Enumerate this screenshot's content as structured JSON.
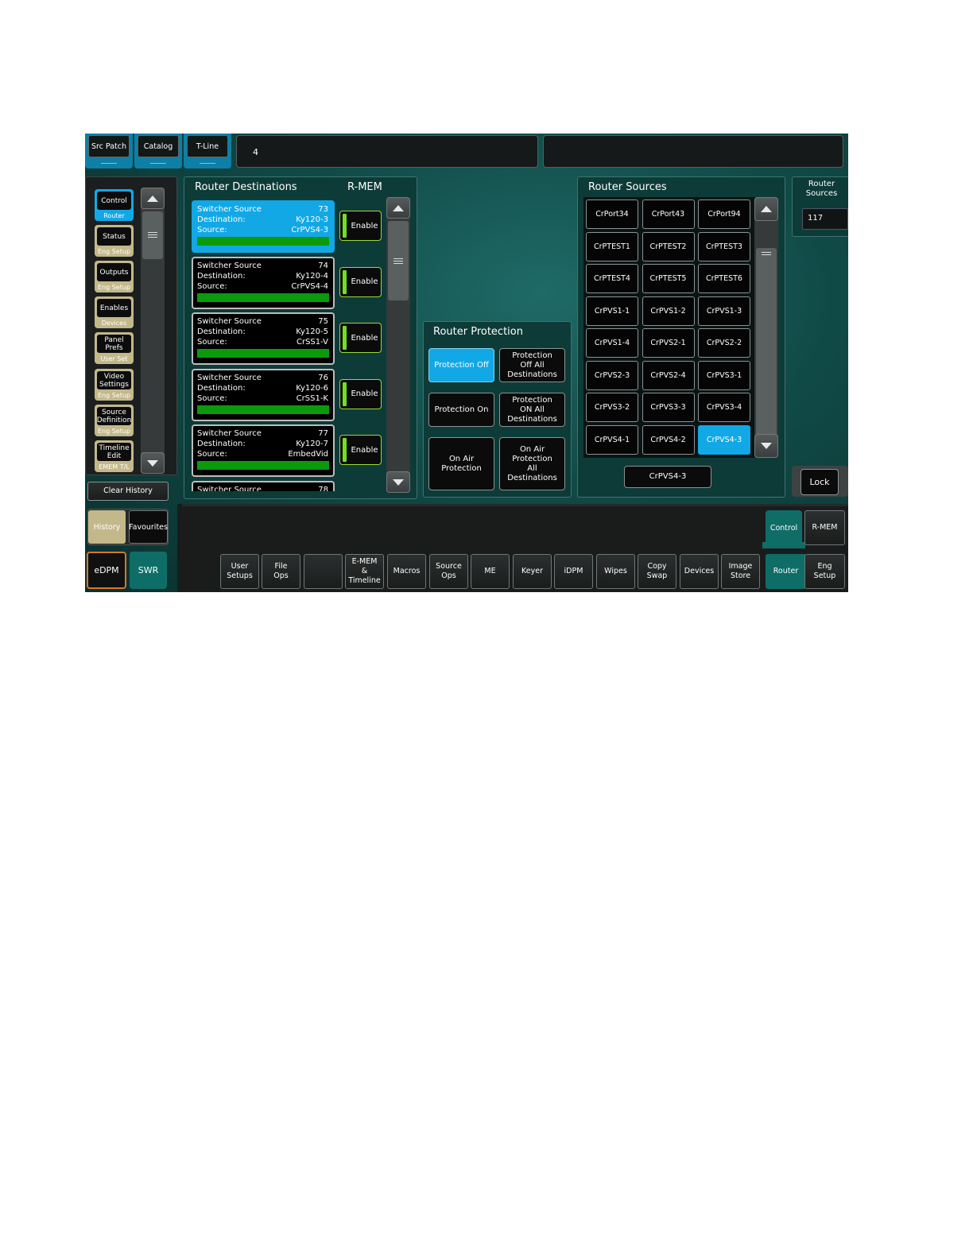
{
  "top_tabs": [
    "Src Patch",
    "Catalog",
    "T-Line"
  ],
  "top_field_value": "4",
  "top_field_right_value": "",
  "sidebar": {
    "items": [
      {
        "label": "Control",
        "sub": "Router",
        "active": true
      },
      {
        "label": "Status",
        "sub": "Eng  Setup"
      },
      {
        "label": "Outputs",
        "sub": "Eng  Setup"
      },
      {
        "label": "Enables",
        "sub": "Devices"
      },
      {
        "label": "Panel Prefs",
        "sub": "User Set"
      },
      {
        "label": "Video Settings",
        "sub": "Eng  Setup"
      },
      {
        "label": "Source Definition",
        "sub": "Eng  Setup"
      },
      {
        "label": "Timeline Edit",
        "sub": "EMEM T/L"
      }
    ],
    "clear_history": "Clear History",
    "history": "History",
    "favourites": "Favourites",
    "edpm": "eDPM",
    "swr": "SWR"
  },
  "destinations": {
    "title": "Router Destinations",
    "rmem_title": "R-MEM",
    "enable_label": "Enable",
    "row_labels": {
      "source_type": "Switcher Source",
      "destination": "Destination:",
      "source": "Source:"
    },
    "items": [
      {
        "num": "73",
        "destination": "Ky120-3",
        "source": "CrPVS4-3",
        "selected": true
      },
      {
        "num": "74",
        "destination": "Ky120-4",
        "source": "CrPVS4-4"
      },
      {
        "num": "75",
        "destination": "Ky120-5",
        "source": "CrSS1-V"
      },
      {
        "num": "76",
        "destination": "Ky120-6",
        "source": "CrSS1-K"
      },
      {
        "num": "77",
        "destination": "Ky120-7",
        "source": "EmbedVid"
      },
      {
        "num": "78",
        "destination": "",
        "source": ""
      }
    ]
  },
  "protection": {
    "title": "Router Protection",
    "buttons": [
      "Protection Off",
      "Protection Off All Destinations",
      "Protection On",
      "Protection ON All Destinations",
      "On Air Protection",
      "On Air Protection All Destinations"
    ]
  },
  "sources": {
    "title": "Router Sources",
    "items": [
      "CrPort34",
      "CrPort43",
      "CrPort94",
      "CrPTEST1",
      "CrPTEST2",
      "CrPTEST3",
      "CrPTEST4",
      "CrPTEST5",
      "CrPTEST6",
      "CrPVS1-1",
      "CrPVS1-2",
      "CrPVS1-3",
      "CrPVS1-4",
      "CrPVS2-1",
      "CrPVS2-2",
      "CrPVS2-3",
      "CrPVS2-4",
      "CrPVS3-1",
      "CrPVS3-2",
      "CrPVS3-3",
      "CrPVS3-4",
      "CrPVS4-1",
      "CrPVS4-2",
      "CrPVS4-3"
    ],
    "selected": "CrPVS4-3",
    "current": "CrPVS4-3"
  },
  "router_sources_box": {
    "label": "Router Sources",
    "value": "117"
  },
  "lock": "Lock",
  "mode_tabs": [
    "Control",
    "R-MEM"
  ],
  "bottom_nav": [
    "User Setups",
    "File Ops",
    "",
    "E-MEM & Timeline",
    "Macros",
    "Source Ops",
    "ME",
    "Keyer",
    "iDPM",
    "Wipes",
    "Copy Swap",
    "Devices",
    "Image Store",
    "Router",
    "Eng Setup"
  ],
  "colors": {
    "selected": "#12a8e6",
    "enable_accent": "#6fe023",
    "progress": "#0b9a0b",
    "tab_active": "#0f6d68",
    "sidebar_tan": "#c3b88a"
  }
}
